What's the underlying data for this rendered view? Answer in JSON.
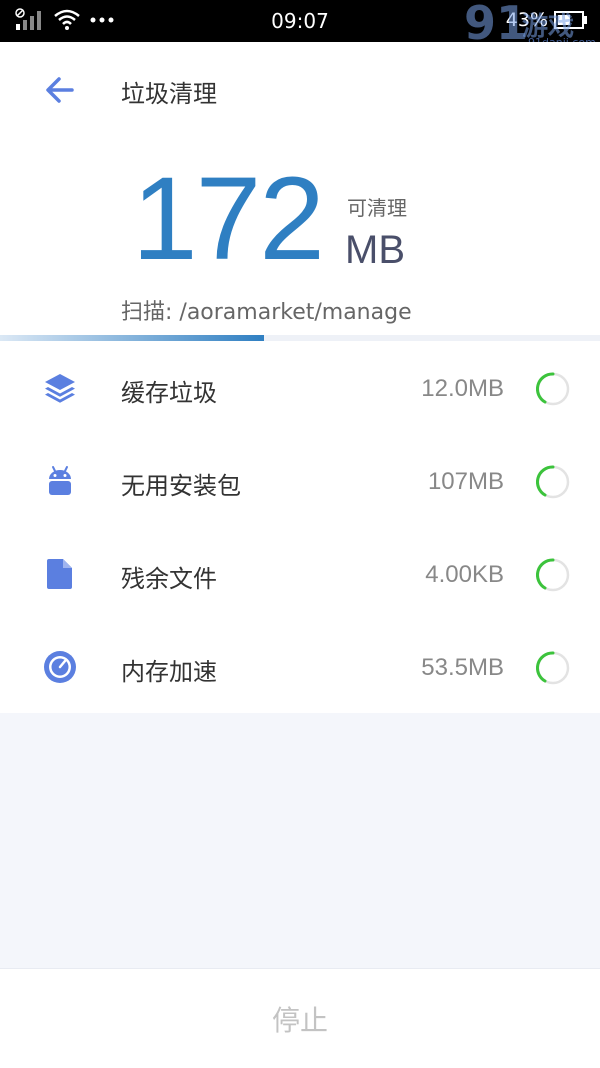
{
  "status_bar": {
    "time": "09:07",
    "battery": "43%"
  },
  "watermark": {
    "number": "91",
    "text": "游戏",
    "domain": "91danji.com"
  },
  "header": {
    "title": "垃圾清理"
  },
  "summary": {
    "amount": "172",
    "clean_label": "可清理",
    "unit": "MB",
    "scan_text": "扫描: /aoramarket/manage",
    "progress": 0.44
  },
  "items": [
    {
      "label": "缓存垃圾",
      "size": "12.0MB",
      "icon": "layers-icon"
    },
    {
      "label": "无用安装包",
      "size": "107MB",
      "icon": "android-icon"
    },
    {
      "label": "残余文件",
      "size": "4.00KB",
      "icon": "file-icon"
    },
    {
      "label": "内存加速",
      "size": "53.5MB",
      "icon": "speedometer-icon"
    }
  ],
  "footer": {
    "stop_label": "停止"
  },
  "colors": {
    "accent": "#2f7fc2",
    "icon": "#5b7fe0",
    "spinner": "#3cc33c"
  }
}
